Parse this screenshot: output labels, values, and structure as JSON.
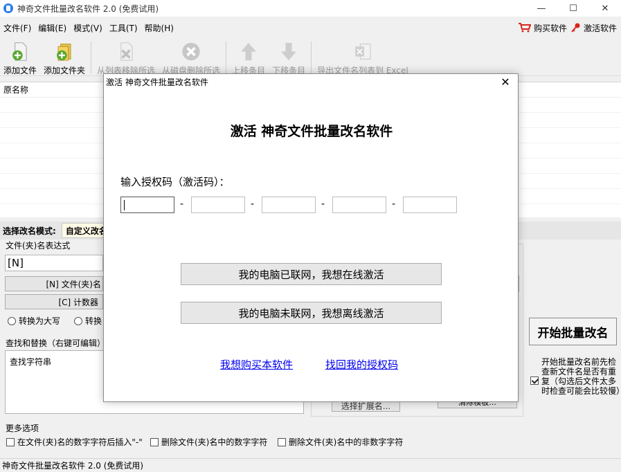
{
  "window": {
    "title": "神奇文件批量改名软件 2.0 (免费试用)",
    "minimize": "—",
    "maximize": "☐",
    "close": "✕"
  },
  "menu": {
    "items": [
      "文件(F)",
      "编辑(E)",
      "模式(V)",
      "工具(T)",
      "帮助(H)"
    ],
    "buy": "购买软件",
    "activate": "激活软件"
  },
  "toolbar": {
    "add_file": "添加文件",
    "add_folder": "添加文件夹",
    "remove_from_list": "从列表移除所选",
    "delete_from_disk": "从磁盘删除所选",
    "move_up": "上移条目",
    "move_down": "下移条目",
    "export_excel": "导出文件名列表到 Excel"
  },
  "filelist": {
    "header": "原名称"
  },
  "mode": {
    "label": "选择改名模式:",
    "selected": "自定义改名"
  },
  "expression": {
    "group_title": "文件(夹)名表达式",
    "value": "[N]",
    "btn_name": "[N] 文件(夹)名",
    "btn_counter": "[C] 计数器",
    "radio_upper": "转换为大写",
    "radio_lower": "转换"
  },
  "find_replace": {
    "group_title": "查找和替换（右键可编辑）",
    "column": "查找字符串"
  },
  "ext_button": "选择扩展名...",
  "clear_button": "清除模板...",
  "start": {
    "button": "开始批量改名",
    "note": "开始批量改名前先检查新文件名是否有重复（勾选后文件太多时检查可能会比较慢）"
  },
  "more_options": {
    "title": "更多选项",
    "opt1": "在文件(夹)名的数字字符后插入\"-\"",
    "opt2": "删除文件(夹)名中的数字字符",
    "opt3": "删除文件(夹)名中的非数字字符"
  },
  "status": "神奇文件批量改名软件 2.0 (免费试用)",
  "dialog": {
    "title": "激活 神奇文件批量改名软件",
    "heading": "激活 神奇文件批量改名软件",
    "code_label": "输入授权码（激活码）：",
    "online_button": "我的电脑已联网，我想在线激活",
    "offline_button": "我的电脑未联网，我想离线激活",
    "buy_link": "我想购买本软件",
    "recover_link": "找回我的授权码",
    "close": "✕"
  }
}
